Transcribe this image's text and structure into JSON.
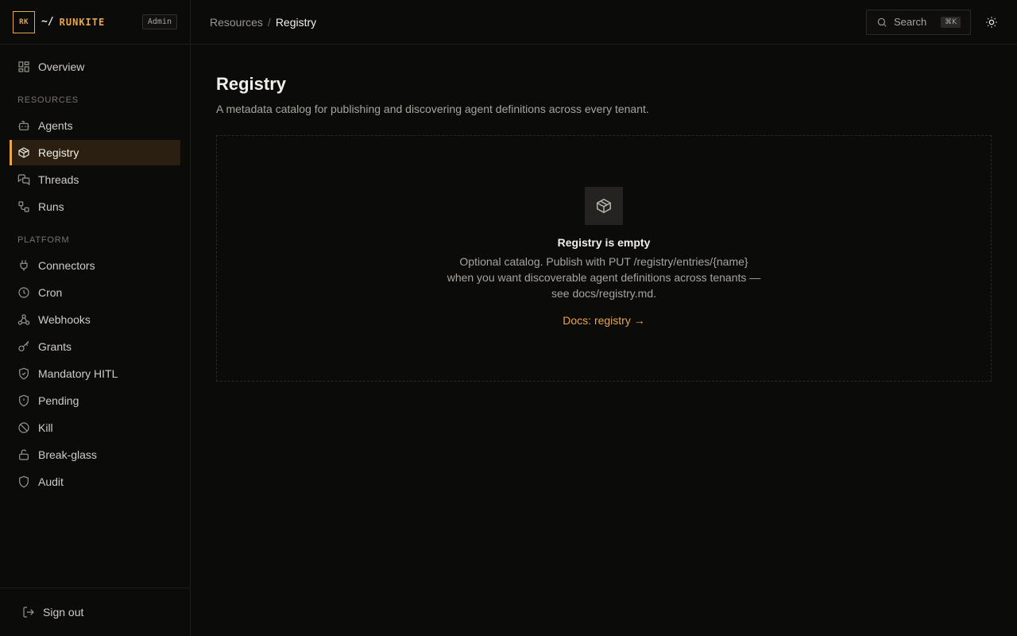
{
  "brand": {
    "logo_text": "RK",
    "prefix": "~/",
    "name": "RUNKITE",
    "badge": "Admin"
  },
  "nav": {
    "overview": "Overview",
    "resources_label": "RESOURCES",
    "resources": [
      {
        "label": "Agents",
        "icon": "bot-icon"
      },
      {
        "label": "Registry",
        "icon": "package-icon",
        "active": true
      },
      {
        "label": "Threads",
        "icon": "messages-icon"
      },
      {
        "label": "Runs",
        "icon": "workflow-icon"
      }
    ],
    "platform_label": "PLATFORM",
    "platform": [
      {
        "label": "Connectors",
        "icon": "plug-icon"
      },
      {
        "label": "Cron",
        "icon": "clock-icon"
      },
      {
        "label": "Webhooks",
        "icon": "webhook-icon"
      },
      {
        "label": "Grants",
        "icon": "key-icon"
      },
      {
        "label": "Mandatory HITL",
        "icon": "shield-check-icon"
      },
      {
        "label": "Pending",
        "icon": "shield-alert-icon"
      },
      {
        "label": "Kill",
        "icon": "ban-icon"
      },
      {
        "label": "Break-glass",
        "icon": "lock-open-icon"
      },
      {
        "label": "Audit",
        "icon": "shield-icon"
      }
    ],
    "sign_out": "Sign out"
  },
  "topbar": {
    "breadcrumb_parent": "Resources",
    "breadcrumb_sep": "/",
    "breadcrumb_current": "Registry",
    "search_label": "Search",
    "search_shortcut": "⌘K"
  },
  "page": {
    "title": "Registry",
    "subtitle": "A metadata catalog for publishing and discovering agent definitions across every tenant."
  },
  "empty_state": {
    "title": "Registry is empty",
    "description": "Optional catalog. Publish with PUT /registry/entries/{name} when you want discoverable agent definitions across tenants — see docs/registry.md.",
    "link": "Docs: registry →"
  },
  "colors": {
    "accent": "#e8a54b",
    "background": "#0b0b0a",
    "border": "#1f1e1c"
  }
}
